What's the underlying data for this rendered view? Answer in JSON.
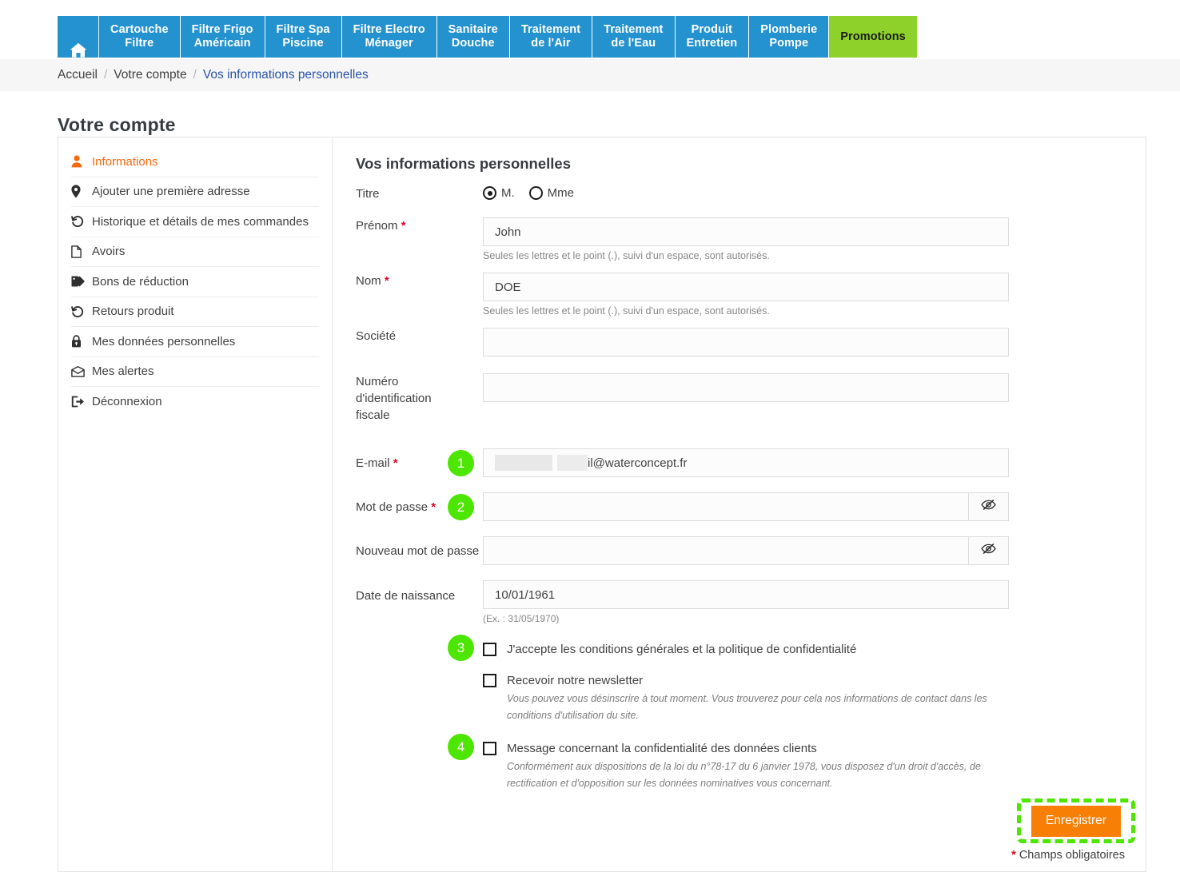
{
  "nav": {
    "home_label": "Accueil",
    "items": [
      {
        "label": "Cartouche\nFiltre",
        "kind": "normal"
      },
      {
        "label": "Filtre Frigo\nAméricain",
        "kind": "normal"
      },
      {
        "label": "Filtre Spa\nPiscine",
        "kind": "normal"
      },
      {
        "label": "Filtre Electro\nMénager",
        "kind": "normal"
      },
      {
        "label": "Sanitaire\nDouche",
        "kind": "normal"
      },
      {
        "label": "Traitement\nde l'Air",
        "kind": "normal"
      },
      {
        "label": "Traitement\nde l'Eau",
        "kind": "normal"
      },
      {
        "label": "Produit\nEntretien",
        "kind": "normal"
      },
      {
        "label": "Plomberie\nPompe",
        "kind": "normal"
      },
      {
        "label": "Promotions",
        "kind": "promo"
      }
    ],
    "colors": {
      "primary": "#2492ce",
      "promo": "#8ed12a"
    }
  },
  "breadcrumb": {
    "items": [
      "Accueil",
      "Votre compte",
      "Vos informations personnelles"
    ],
    "separator": "/",
    "current_color": "#2b55a8"
  },
  "page_title": "Votre compte",
  "sidebar": {
    "items": [
      {
        "label": "Informations",
        "icon": "user-icon",
        "active": true
      },
      {
        "label": "Ajouter une première adresse",
        "icon": "map-pin-icon",
        "active": false
      },
      {
        "label": "Historique et détails de mes commandes",
        "icon": "history-icon",
        "active": false
      },
      {
        "label": "Avoirs",
        "icon": "file-icon",
        "active": false
      },
      {
        "label": "Bons de réduction",
        "icon": "tag-icon",
        "active": false
      },
      {
        "label": "Retours produit",
        "icon": "undo-icon",
        "active": false
      },
      {
        "label": "Mes données personnelles",
        "icon": "lock-icon",
        "active": false
      },
      {
        "label": "Mes alertes",
        "icon": "envelope-icon",
        "active": false
      },
      {
        "label": "Déconnexion",
        "icon": "signout-icon",
        "active": false
      }
    ],
    "active_color": "#f5690f"
  },
  "form": {
    "title": "Vos informations personnelles",
    "title_field": {
      "label": "Titre",
      "options": [
        {
          "label": "M.",
          "selected": true
        },
        {
          "label": "Mme",
          "selected": false
        }
      ]
    },
    "firstname": {
      "label": "Prénom",
      "required": true,
      "value": "John",
      "help": "Seules les lettres et le point (.), suivi d'un espace, sont autorisés."
    },
    "lastname": {
      "label": "Nom",
      "required": true,
      "value": "DOE",
      "help": "Seules les lettres et le point (.), suivi d'un espace, sont autorisés."
    },
    "company": {
      "label": "Société",
      "required": false,
      "value": ""
    },
    "tax_id": {
      "label": "Numéro d'identification fiscale",
      "required": false,
      "value": ""
    },
    "email": {
      "label": "E-mail",
      "required": true,
      "value_visible": "il@waterconcept.fr",
      "redacted": true,
      "badge": "1"
    },
    "password": {
      "label": "Mot de passe",
      "required": true,
      "value": "",
      "toggle_icon": "eye-slash-icon",
      "badge": "2"
    },
    "new_password": {
      "label": "Nouveau mot de passe",
      "required": false,
      "value": "",
      "toggle_icon": "eye-slash-icon"
    },
    "birthdate": {
      "label": "Date de naissance",
      "required": false,
      "value": "10/01/1961",
      "help": "(Ex. : 31/05/1970)"
    },
    "checkboxes": [
      {
        "label": "J'accepte les conditions générales et la politique de confidentialité",
        "checked": false,
        "note": "",
        "badge": "3"
      },
      {
        "label": "Recevoir notre newsletter",
        "checked": false,
        "note": "Vous pouvez vous désinscrire à tout moment. Vous trouverez pour cela nos informations de contact dans les conditions d'utilisation du site.",
        "badge": ""
      },
      {
        "label": "Message concernant la confidentialité des données clients",
        "checked": false,
        "note": "Conformément aux dispositions de la loi du n°78-17 du 6 janvier 1978, vous disposez d'un droit d'accès, de rectification et d'opposition sur les données nominatives vous concernant.",
        "badge": "4"
      }
    ],
    "submit_label": "Enregistrer",
    "required_star": "*",
    "required_note": "Champs obligatoires",
    "colors": {
      "submit_bg": "#f77f06",
      "badge_bg": "#4ce600",
      "highlight": "#4ce600",
      "required": "#e3001b"
    }
  }
}
